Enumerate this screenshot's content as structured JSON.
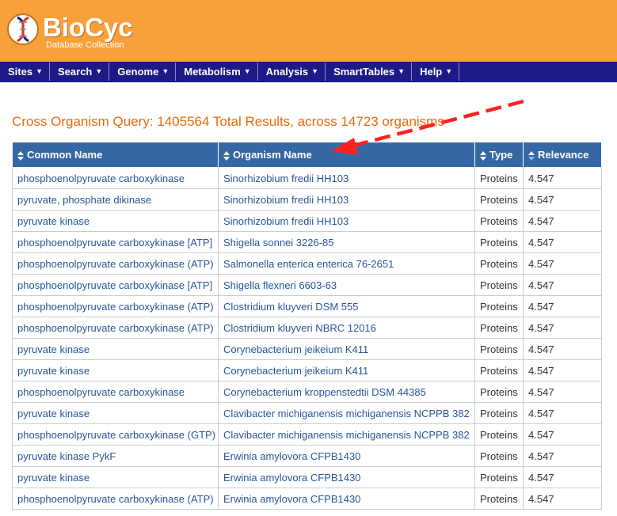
{
  "header": {
    "logo_text": "BioCyc",
    "logo_subtitle": "Database Collection",
    "accent_color": "#f8a03a"
  },
  "nav": {
    "items": [
      {
        "label": "Sites"
      },
      {
        "label": "Search"
      },
      {
        "label": "Genome"
      },
      {
        "label": "Metabolism"
      },
      {
        "label": "Analysis"
      },
      {
        "label": "SmartTables"
      },
      {
        "label": "Help"
      }
    ],
    "color": "#1d1a87"
  },
  "query": {
    "title": "Cross Organism Query: 1405564 Total Results, across 14723 organisms"
  },
  "table": {
    "columns": [
      "Common Name",
      "Organism Name",
      "Type",
      "Relevance"
    ],
    "rows": [
      {
        "common": "phosphoenolpyruvate carboxykinase",
        "organism": "Sinorhizobium fredii HH103",
        "type": "Proteins",
        "relevance": "4.547"
      },
      {
        "common": "pyruvate, phosphate dikinase",
        "organism": "Sinorhizobium fredii HH103",
        "type": "Proteins",
        "relevance": "4.547"
      },
      {
        "common": "pyruvate kinase",
        "organism": "Sinorhizobium fredii HH103",
        "type": "Proteins",
        "relevance": "4.547"
      },
      {
        "common": "phosphoenolpyruvate carboxykinase [ATP]",
        "organism": "Shigella sonnei 3226-85",
        "type": "Proteins",
        "relevance": "4.547"
      },
      {
        "common": "phosphoenolpyruvate carboxykinase (ATP)",
        "organism": "Salmonella enterica enterica 76-2651",
        "type": "Proteins",
        "relevance": "4.547"
      },
      {
        "common": "phosphoenolpyruvate carboxykinase [ATP]",
        "organism": "Shigella flexneri 6603-63",
        "type": "Proteins",
        "relevance": "4.547"
      },
      {
        "common": "phosphoenolpyruvate carboxykinase (ATP)",
        "organism": "Clostridium kluyveri DSM 555",
        "type": "Proteins",
        "relevance": "4.547"
      },
      {
        "common": "phosphoenolpyruvate carboxykinase (ATP)",
        "organism": "Clostridium kluyveri NBRC 12016",
        "type": "Proteins",
        "relevance": "4.547"
      },
      {
        "common": "pyruvate kinase",
        "organism": "Corynebacterium jeikeium K411",
        "type": "Proteins",
        "relevance": "4.547"
      },
      {
        "common": "pyruvate kinase",
        "organism": "Corynebacterium jeikeium K411",
        "type": "Proteins",
        "relevance": "4.547"
      },
      {
        "common": "phosphoenolpyruvate carboxykinase",
        "organism": "Corynebacterium kroppenstedtii DSM 44385",
        "type": "Proteins",
        "relevance": "4.547"
      },
      {
        "common": "pyruvate kinase",
        "organism": "Clavibacter michiganensis michiganensis NCPPB 382",
        "type": "Proteins",
        "relevance": "4.547"
      },
      {
        "common": "phosphoenolpyruvate carboxykinase (GTP)",
        "organism": "Clavibacter michiganensis michiganensis NCPPB 382",
        "type": "Proteins",
        "relevance": "4.547"
      },
      {
        "common": "pyruvate kinase PykF",
        "organism": "Erwinia amylovora CFPB1430",
        "type": "Proteins",
        "relevance": "4.547"
      },
      {
        "common": "pyruvate kinase",
        "organism": "Erwinia amylovora CFPB1430",
        "type": "Proteins",
        "relevance": "4.547"
      },
      {
        "common": "phosphoenolpyruvate carboxykinase (ATP)",
        "organism": "Erwinia amylovora CFPB1430",
        "type": "Proteins",
        "relevance": "4.547"
      }
    ]
  }
}
